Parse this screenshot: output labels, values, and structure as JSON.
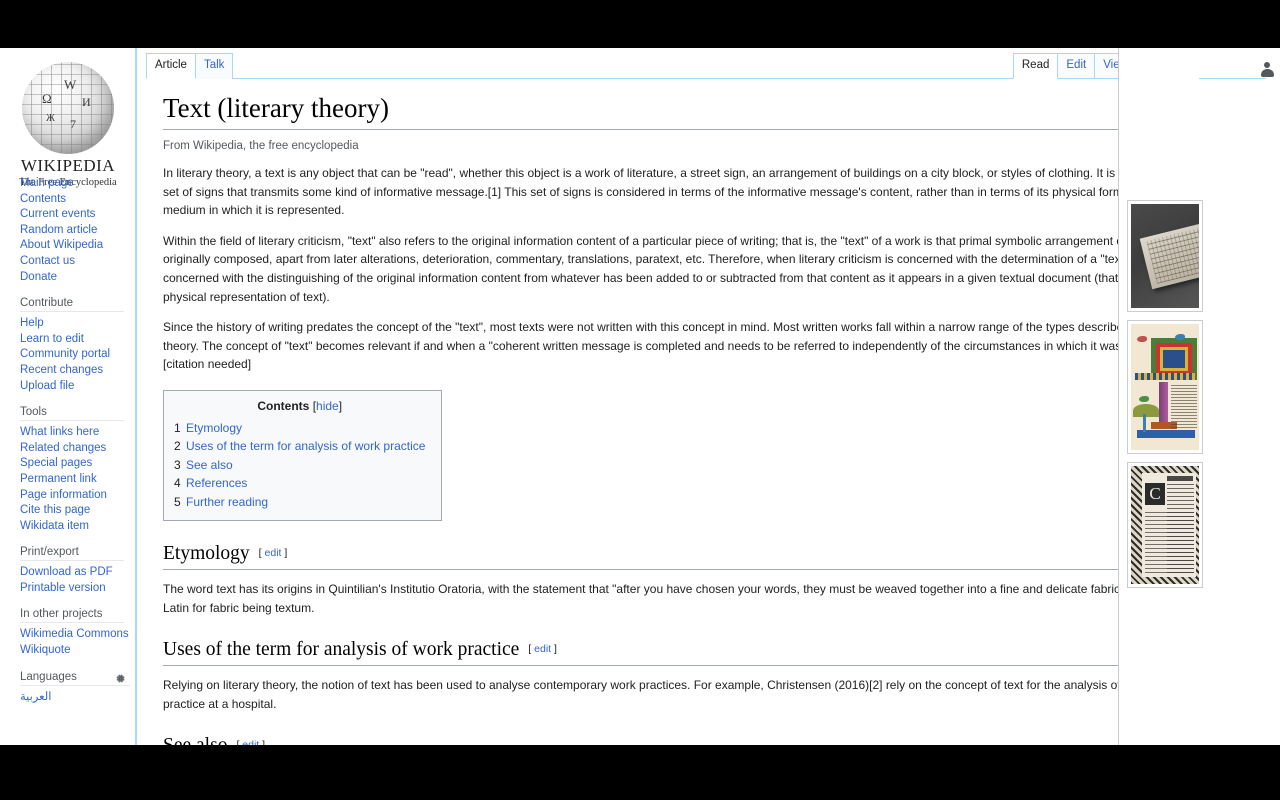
{
  "site": {
    "wordmark": "WIKIPEDIA",
    "tagline": "The Free Encyclopedia",
    "globe_glyphs": [
      "W",
      "Ω",
      "И",
      "7",
      "Ж"
    ]
  },
  "sidebar": {
    "main_links": [
      {
        "label": "Main page"
      },
      {
        "label": "Contents"
      },
      {
        "label": "Current events"
      },
      {
        "label": "Random article"
      },
      {
        "label": "About Wikipedia"
      },
      {
        "label": "Contact us"
      },
      {
        "label": "Donate"
      }
    ],
    "contribute_heading": "Contribute",
    "contribute_links": [
      {
        "label": "Help"
      },
      {
        "label": "Learn to edit"
      },
      {
        "label": "Community portal"
      },
      {
        "label": "Recent changes"
      },
      {
        "label": "Upload file"
      }
    ],
    "tools_heading": "Tools",
    "tools_links": [
      {
        "label": "What links here"
      },
      {
        "label": "Related changes"
      },
      {
        "label": "Special pages"
      },
      {
        "label": "Permanent link"
      },
      {
        "label": "Page information"
      },
      {
        "label": "Cite this page"
      },
      {
        "label": "Wikidata item"
      }
    ],
    "print_heading": "Print/export",
    "print_links": [
      {
        "label": "Download as PDF"
      },
      {
        "label": "Printable version"
      }
    ],
    "projects_heading": "In other projects",
    "projects_links": [
      {
        "label": "Wikimedia Commons"
      },
      {
        "label": "Wikiquote"
      }
    ],
    "languages_heading": "Languages",
    "languages_first": "العربية"
  },
  "tabs": {
    "left": [
      {
        "label": "Article",
        "selected": true
      },
      {
        "label": "Talk",
        "selected": false
      }
    ],
    "right": [
      {
        "label": "Read",
        "selected": true
      },
      {
        "label": "Edit",
        "selected": false
      },
      {
        "label": "View history",
        "selected": false
      }
    ]
  },
  "article": {
    "title": "Text (literary theory)",
    "subtitle": "From Wikipedia, the free encyclopedia",
    "paragraphs": [
      "In literary theory, a text is any object that can be \"read\", whether this object is a work of literature, a street sign, an arrangement of buildings on a city block, or styles of clothing. It is a coherent set of signs that transmits some kind of informative message.[1] This set of signs is considered in terms of the informative message's content, rather than in terms of its physical form or the medium in which it is represented.",
      "Within the field of literary criticism, \"text\" also refers to the original information content of a particular piece of writing; that is, the \"text\" of a work is that primal symbolic arrangement of letters as originally composed, apart from later alterations, deterioration, commentary, translations, paratext, etc. Therefore, when literary criticism is concerned with the determination of a \"text\", it is concerned with the distinguishing of the original information content from whatever has been added to or subtracted from that content as it appears in a given textual document (that is, a physical representation of text).",
      "Since the history of writing predates the concept of the \"text\", most texts were not written with this concept in mind. Most written works fall within a narrow range of the types described by text theory. The concept of \"text\" becomes relevant if and when a \"coherent written message is completed and needs to be referred to independently of the circumstances in which it was created.\" [citation needed]"
    ],
    "toc": {
      "title": "Contents",
      "toggle_open": "[",
      "toggle_label": "hide",
      "toggle_close": "]",
      "entries": [
        {
          "num": "1",
          "label": "Etymology"
        },
        {
          "num": "2",
          "label": "Uses of the term for analysis of work practice"
        },
        {
          "num": "3",
          "label": "See also"
        },
        {
          "num": "4",
          "label": "References"
        },
        {
          "num": "5",
          "label": "Further reading"
        }
      ]
    },
    "sections": [
      {
        "heading": "Etymology",
        "edit_open": "[",
        "edit_label": "edit",
        "edit_close": "]",
        "body": "The word text has its origins in Quintilian's Institutio Oratoria, with the statement that \"after you have chosen your words, they must be weaved together into a fine and delicate fabric\", with the Latin for fabric being textum."
      },
      {
        "heading": "Uses of the term for analysis of work practice",
        "edit_open": "[",
        "edit_label": "edit",
        "edit_close": "]",
        "body": "Relying on literary theory, the notion of text has been used to analyse contemporary work practices. For example, Christensen (2016)[2] rely on the concept of text for the analysis of work practice at a hospital."
      },
      {
        "heading": "See also",
        "edit_open": "[",
        "edit_label": "edit",
        "edit_close": "]",
        "body": ""
      }
    ]
  },
  "rail": {
    "images": [
      {
        "caption": "stone-tablet-inscription"
      },
      {
        "caption": "illuminated-manuscript-page"
      },
      {
        "caption": "gothic-printed-page"
      }
    ]
  },
  "colors": {
    "link": "#3366cc",
    "border_blue": "#a7d7f9",
    "text": "#202122",
    "muted": "#54595d"
  }
}
